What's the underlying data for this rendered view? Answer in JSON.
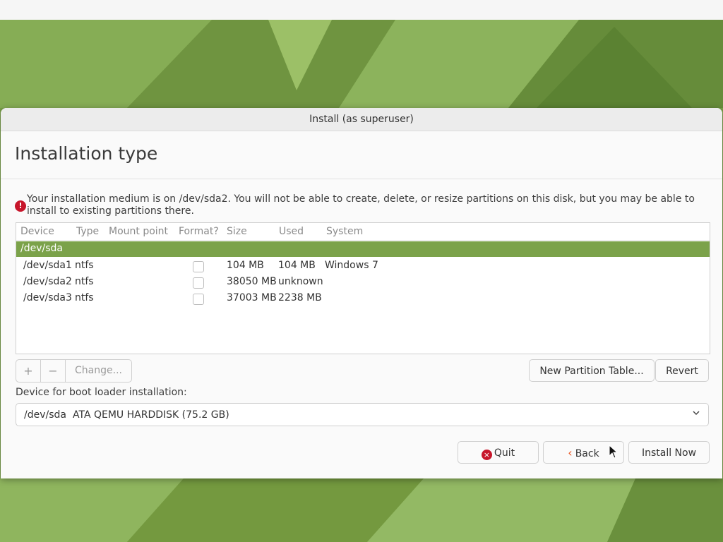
{
  "window": {
    "title": "Install (as superuser)"
  },
  "page": {
    "title": "Installation type"
  },
  "warning": {
    "icon": "error-icon",
    "text": "Your installation medium is on /dev/sda2. You will not be able to create, delete, or resize partitions on this disk, but you may be able to install to existing partitions there."
  },
  "table": {
    "headers": [
      "Device",
      "Type",
      "Mount point",
      "Format?",
      "Size",
      "Used",
      "System"
    ],
    "disk": "/dev/sda",
    "rows": [
      {
        "device": "/dev/sda1",
        "type": "ntfs",
        "mount": "",
        "format": false,
        "size": "104 MB",
        "used": "104 MB",
        "system": "Windows 7"
      },
      {
        "device": "/dev/sda2",
        "type": "ntfs",
        "mount": "",
        "format": false,
        "size": "38050 MB",
        "used": "unknown",
        "system": ""
      },
      {
        "device": "/dev/sda3",
        "type": "ntfs",
        "mount": "",
        "format": false,
        "size": "37003 MB",
        "used": "2238 MB",
        "system": ""
      }
    ]
  },
  "toolbar": {
    "add": "+",
    "remove": "−",
    "change": "Change...",
    "new_table": "New Partition Table...",
    "revert": "Revert"
  },
  "bootloader": {
    "label": "Device for boot loader installation:",
    "device": "/dev/sda",
    "description": "ATA QEMU HARDDISK (75.2 GB)"
  },
  "buttons": {
    "quit": "Quit",
    "back": "Back",
    "install": "Install Now"
  },
  "colors": {
    "accent": "#7ba24a",
    "error": "#c7162b",
    "back_icon": "#e95420"
  }
}
